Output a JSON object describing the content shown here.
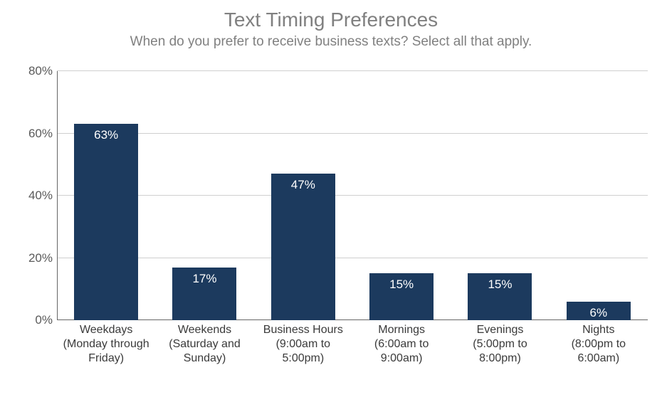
{
  "chart_data": {
    "type": "bar",
    "title": "Text Timing Preferences",
    "subtitle": "When do you prefer to receive business texts? Select all that apply.",
    "categories": [
      {
        "line1": "Weekdays",
        "line2": "(Monday through Friday)"
      },
      {
        "line1": "Weekends",
        "line2": "(Saturday and Sunday)"
      },
      {
        "line1": "Business Hours",
        "line2": "(9:00am to 5:00pm)"
      },
      {
        "line1": "Mornings",
        "line2": "(6:00am to 9:00am)"
      },
      {
        "line1": "Evenings",
        "line2": "(5:00pm to 8:00pm)"
      },
      {
        "line1": "Nights",
        "line2": "(8:00pm to 6:00am)"
      }
    ],
    "values": [
      63,
      17,
      47,
      15,
      15,
      6
    ],
    "value_labels": [
      "63%",
      "17%",
      "47%",
      "15%",
      "15%",
      "6%"
    ],
    "xlabel": "",
    "ylabel": "",
    "ylim": [
      0,
      80
    ],
    "y_ticks": [
      0,
      20,
      40,
      60,
      80
    ],
    "y_tick_labels": [
      "0%",
      "20%",
      "40%",
      "60%",
      "80%"
    ],
    "bar_color": "#1c3a5e"
  }
}
